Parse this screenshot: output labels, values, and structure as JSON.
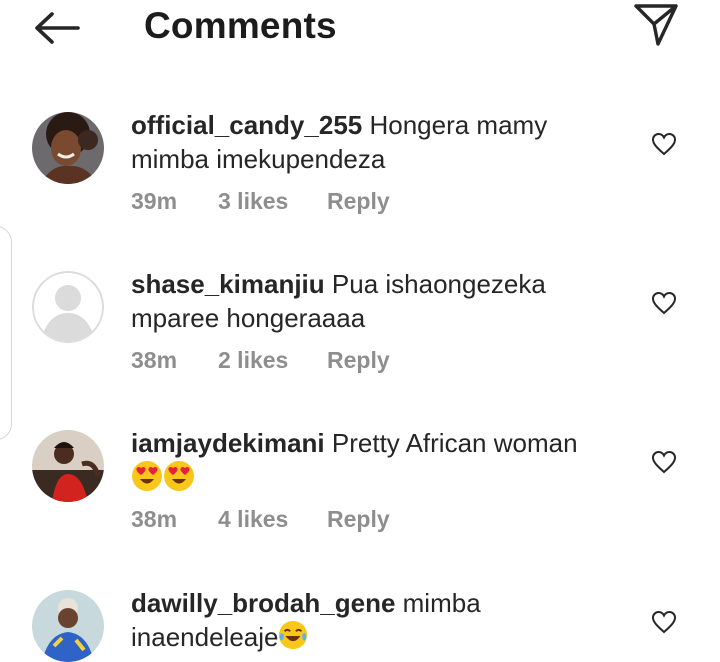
{
  "header": {
    "title": "Comments",
    "back_icon": "arrow-left-icon",
    "share_icon": "paper-plane-icon"
  },
  "comments": [
    {
      "username": "official_candy_255",
      "text": "Hongera mamy mimba imekupendeza",
      "time": "39m",
      "likes": "3 likes",
      "reply": "Reply",
      "emojis": []
    },
    {
      "username": "shase_kimanjiu",
      "text": "Pua ishaongezeka mparee hongeraaaa",
      "time": "38m",
      "likes": "2 likes",
      "reply": "Reply",
      "emojis": []
    },
    {
      "username": "iamjaydekimani",
      "text": "Pretty African woman",
      "time": "38m",
      "likes": "4 likes",
      "reply": "Reply",
      "emojis": [
        "heart-eyes-emoji",
        "heart-eyes-emoji"
      ]
    },
    {
      "username": "dawilly_brodah_gene",
      "text": "mimba inaendeleaje",
      "time": "",
      "likes": "",
      "reply": "",
      "emojis": [
        "tears-of-joy-emoji"
      ]
    }
  ],
  "colors": {
    "text": "#262626",
    "meta": "#8e8e8e",
    "placeholder_avatar": "#dbdbdb"
  }
}
